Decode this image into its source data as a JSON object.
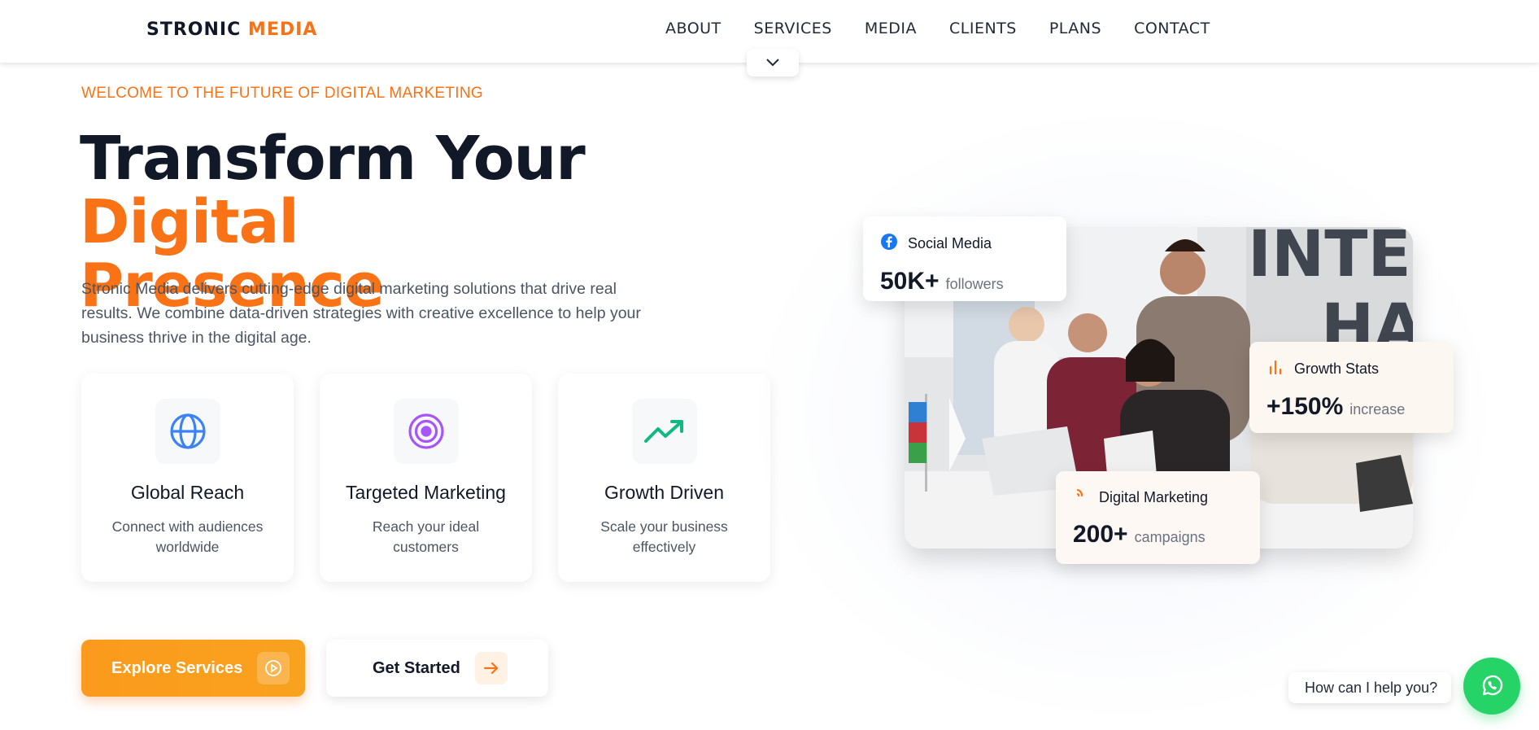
{
  "header": {
    "logo_main": "STRONIC",
    "logo_accent": "MEDIA",
    "nav": [
      "ABOUT",
      "SERVICES",
      "MEDIA",
      "CLIENTS",
      "PLANS",
      "CONTACT"
    ]
  },
  "hero": {
    "eyebrow": "WELCOME TO THE FUTURE OF DIGITAL MARKETING",
    "title_part1": "Transform Your ",
    "title_accent1": "Digital",
    "title_accent2": "Presence",
    "description": "Stronic Media delivers cutting-edge digital marketing solutions that drive real results. We combine data-driven strategies with creative excellence to help your business thrive in the digital age."
  },
  "features": [
    {
      "icon": "globe-icon",
      "title": "Global Reach",
      "text": "Connect with audiences worldwide"
    },
    {
      "icon": "target-icon",
      "title": "Targeted Marketing",
      "text": "Reach your ideal customers"
    },
    {
      "icon": "trending-up-icon",
      "title": "Growth Driven",
      "text": "Scale your business effectively"
    }
  ],
  "buttons": {
    "primary": "Explore Services",
    "secondary": "Get Started"
  },
  "stats": {
    "social": {
      "label": "Social Media",
      "value": "50K+",
      "unit": "followers"
    },
    "growth": {
      "label": "Growth Stats",
      "value": "+150%",
      "unit": "increase"
    },
    "digital": {
      "label": "Digital Marketing",
      "value": "200+",
      "unit": "campaigns"
    }
  },
  "chat": {
    "prompt": "How can I help you?"
  },
  "colors": {
    "accent": "#f97316",
    "whatsapp": "#25d366"
  }
}
